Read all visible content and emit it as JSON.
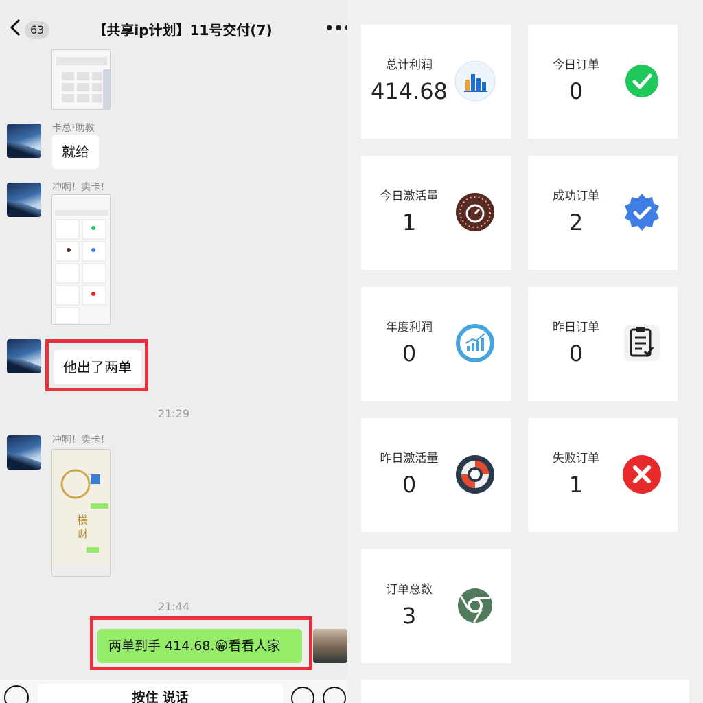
{
  "chat": {
    "title": "【共享ip计划】11号交付(7)",
    "unread_count": "63",
    "messages": {
      "sender1": "卡总¹助教",
      "msg1": "就给",
      "sender2": "冲啊！卖卡！",
      "msg2": "他出了两单",
      "time1": "21:29",
      "sender3": "冲啊！卖卡！",
      "time2": "21:44",
      "self_msg": "两单到手 414.68.😁看看人家"
    },
    "input": {
      "hold_to_talk": "按住 说话"
    }
  },
  "dashboard": {
    "cards": [
      {
        "label": "总计利润",
        "value": "414.68",
        "icon": "bar-chart-icon",
        "color": "#1f6fd1"
      },
      {
        "label": "今日订单",
        "value": "0",
        "icon": "check-circle-icon",
        "color": "#1ec85a"
      },
      {
        "label": "今日激活量",
        "value": "1",
        "icon": "timer-icon",
        "color": "#5a2b22"
      },
      {
        "label": "成功订单",
        "value": "2",
        "icon": "verified-badge-icon",
        "color": "#3d7de4"
      },
      {
        "label": "年度利润",
        "value": "0",
        "icon": "growth-chart-icon",
        "color": "#46a4de"
      },
      {
        "label": "昨日订单",
        "value": "0",
        "icon": "clipboard-check-icon",
        "color": "#222222"
      },
      {
        "label": "昨日激活量",
        "value": "0",
        "icon": "lifebuoy-icon",
        "color": "#2b3a4a"
      },
      {
        "label": "失败订单",
        "value": "1",
        "icon": "error-circle-icon",
        "color": "#e62a2a"
      },
      {
        "label": "订单总数",
        "value": "3",
        "icon": "chrome-icon",
        "color": "#4f7a5c"
      }
    ]
  }
}
